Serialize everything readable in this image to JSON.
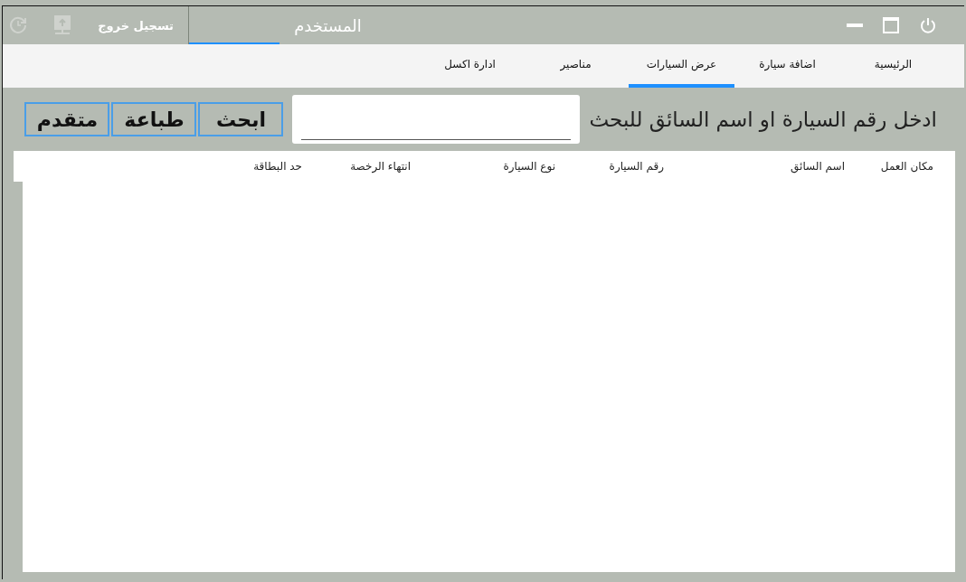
{
  "title_bar": {
    "user_tab": {
      "label": "المستخدم",
      "selected": true
    },
    "logout": "تسجيل خروج",
    "tools": [
      {
        "kind": "upload",
        "disabled": true
      },
      {
        "kind": "history",
        "disabled": true
      }
    ]
  },
  "tabs": [
    {
      "label": "الرئيسية",
      "selected": false
    },
    {
      "label": "اضافة سيارة",
      "selected": false
    },
    {
      "label": "عرض السيارات",
      "selected": true
    },
    {
      "label": "مناصير",
      "selected": false
    },
    {
      "label": "ادارة اكسل",
      "selected": false
    }
  ],
  "search": {
    "label": "ادخل رقم السيارة او اسم السائق للبحث",
    "buttons": [
      "ابحث",
      "طباعة",
      "متقدم"
    ]
  },
  "table": {
    "columns": [
      "مكان العمل",
      "اسم السائق",
      "رقم السيارة",
      "نوع السيارة",
      "انتهاء الرخصة",
      "حد البطاقة"
    ]
  }
}
